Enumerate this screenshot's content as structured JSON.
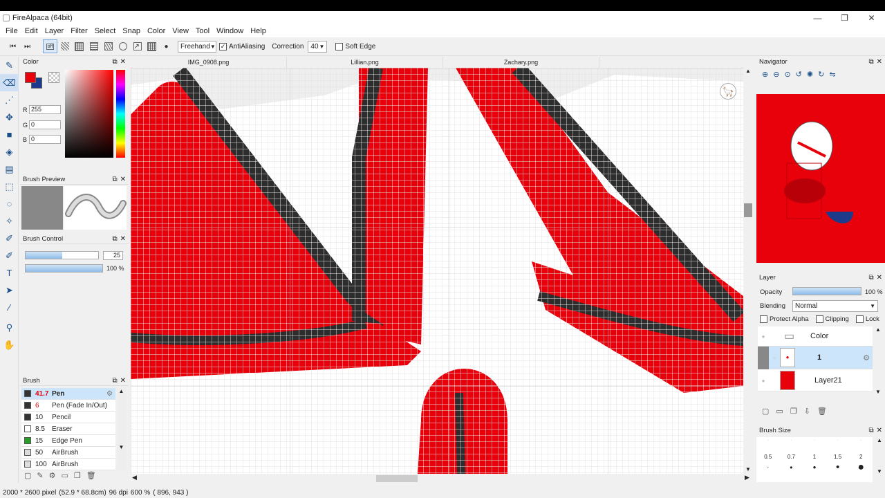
{
  "window": {
    "title": "FireAlpaca (64bit)",
    "min": "—",
    "max": "❐",
    "close": "✕"
  },
  "menu": [
    "File",
    "Edit",
    "Layer",
    "Filter",
    "Select",
    "Snap",
    "Color",
    "View",
    "Tool",
    "Window",
    "Help"
  ],
  "toolbar": {
    "snap_off": "off",
    "stroke_mode": "Freehand",
    "antialiasing_label": "AntiAliasing",
    "antialiasing_checked": "✓",
    "correction_label": "Correction",
    "correction_value": "40",
    "soft_edge_label": "Soft Edge"
  },
  "tabs": [
    "IMG_0908.png",
    "Lillian.png",
    "Zachary.png"
  ],
  "color_panel": {
    "title": "Color",
    "r_label": "R",
    "r": "255",
    "g_label": "G",
    "g": "0",
    "b_label": "B",
    "b": "0",
    "primary": "#e8000b",
    "secondary": "#1e3a8a"
  },
  "brush_preview": {
    "title": "Brush Preview"
  },
  "brush_control": {
    "title": "Brush Control",
    "size": "25",
    "opacity": "100 %",
    "size_fraction": 0.5,
    "opacity_fraction": 1.0
  },
  "brush_panel": {
    "title": "Brush",
    "items": [
      {
        "size": "41.7",
        "name": "Pen",
        "color": "#333"
      },
      {
        "size": "6",
        "name": "Pen (Fade In/Out)",
        "color": "#333"
      },
      {
        "size": "10",
        "name": "Pencil",
        "color": "#333"
      },
      {
        "size": "8.5",
        "name": "Eraser",
        "color": "#fff"
      },
      {
        "size": "15",
        "name": "Edge Pen",
        "color": "#2a9d2a"
      },
      {
        "size": "50",
        "name": "AirBrush",
        "color": "#ddd"
      },
      {
        "size": "100",
        "name": "AirBrush",
        "color": "#ddd"
      }
    ]
  },
  "navigator": {
    "title": "Navigator"
  },
  "layer_panel": {
    "title": "Layer",
    "opacity_label": "Opacity",
    "opacity_value": "100 %",
    "blending_label": "Blending",
    "blending_value": "Normal",
    "protect_alpha": "Protect Alpha",
    "clipping": "Clipping",
    "lock": "Lock",
    "layers": [
      {
        "name": "Color",
        "kind": "folder"
      },
      {
        "name": "1",
        "kind": "layer"
      },
      {
        "name": "Layer21",
        "kind": "layer"
      }
    ]
  },
  "brush_size": {
    "title": "Brush Size",
    "sizes": [
      "0.5",
      "0.7",
      "1",
      "1.5",
      "2"
    ]
  },
  "status": {
    "pixels": "2000 * 2600 pixel",
    "cm": "(52.9 * 68.8cm)",
    "dpi": "96 dpi",
    "zoom": "600 %",
    "coords": "( 896, 943 )"
  }
}
